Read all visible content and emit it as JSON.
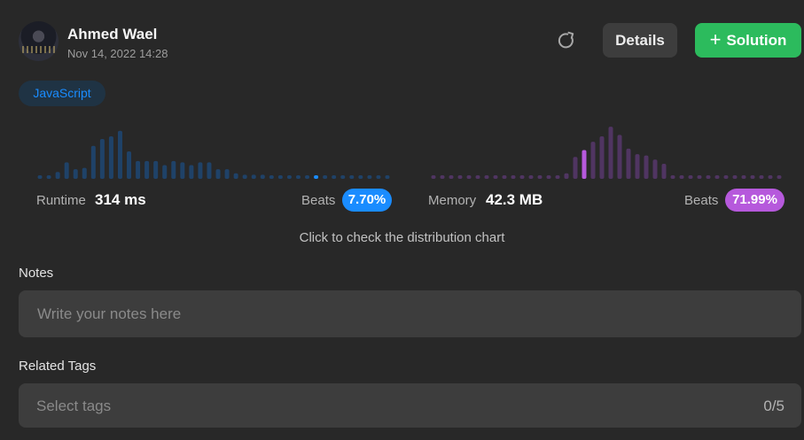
{
  "header": {
    "user_name": "Ahmed Wael",
    "timestamp": "Nov 14, 2022 14:28",
    "avatar_icon": "user-avatar",
    "refresh_icon": "refresh-icon",
    "details_label": "Details",
    "solution_label": "Solution",
    "solution_icon": "plus-icon"
  },
  "language_tag": "JavaScript",
  "runtime": {
    "label": "Runtime",
    "value": "314 ms",
    "beats_label": "Beats",
    "beats_value": "7.70%",
    "color": "#1a8cff",
    "dim_color": "#1f4268"
  },
  "memory": {
    "label": "Memory",
    "value": "42.3 MB",
    "beats_label": "Beats",
    "beats_value": "71.99%",
    "color": "#b659dc",
    "dim_color": "#503562"
  },
  "distribution_link": "Click to check the distribution chart",
  "notes": {
    "label": "Notes",
    "placeholder": "Write your notes here"
  },
  "related_tags": {
    "label": "Related Tags",
    "placeholder": "Select tags",
    "count": "0/5"
  },
  "chart_data": [
    {
      "type": "bar",
      "name": "runtime-distribution",
      "values": [
        1,
        2,
        5,
        12,
        7,
        8,
        24,
        29,
        31,
        35,
        20,
        13,
        13,
        13,
        10,
        13,
        12,
        10,
        12,
        12,
        7,
        7,
        4,
        3,
        3,
        3,
        2,
        1,
        1,
        1,
        1,
        1,
        1,
        1,
        1,
        1,
        1,
        1,
        1,
        1
      ],
      "highlight_index": 31,
      "ylim": [
        0,
        40
      ]
    },
    {
      "type": "bar",
      "name": "memory-distribution",
      "values": [
        1,
        1,
        1,
        1,
        1,
        1,
        1,
        1,
        1,
        1,
        1,
        1,
        1,
        1,
        1,
        4,
        16,
        21,
        27,
        31,
        38,
        32,
        22,
        18,
        17,
        14,
        11,
        2,
        1,
        1,
        1,
        1,
        1,
        1,
        1,
        1,
        1,
        1,
        1,
        1
      ],
      "highlight_index": 17,
      "ylim": [
        0,
        40
      ]
    }
  ]
}
